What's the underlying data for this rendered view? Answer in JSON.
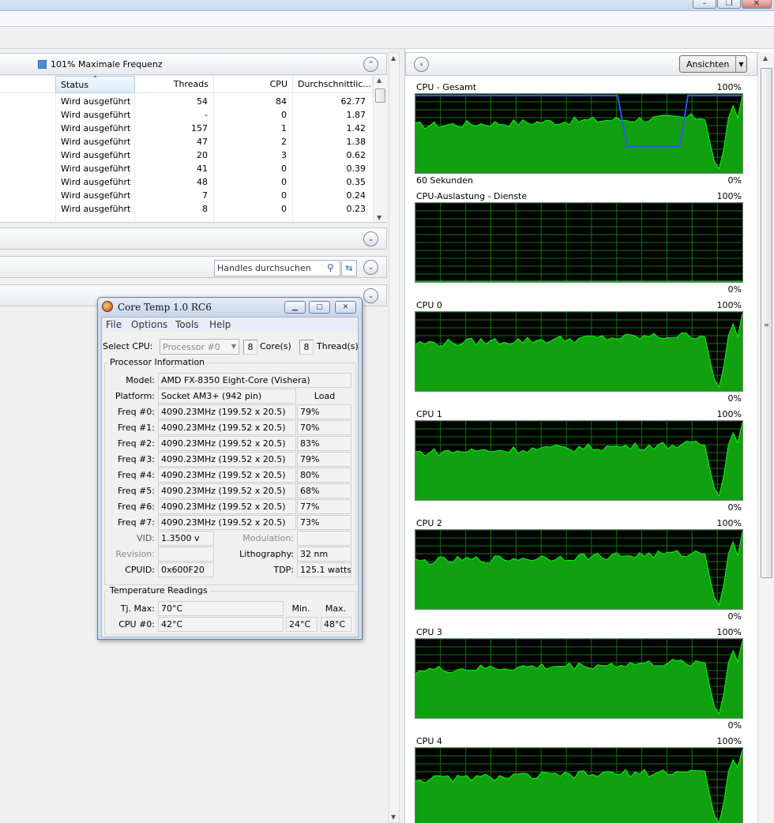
{
  "window": {
    "minimize_glyph": "–",
    "maximize_glyph": "❐",
    "close_glyph": "✕"
  },
  "left_pane": {
    "cpu_section": {
      "legend_label": "101% Maximale Frequenz",
      "legend_color": "#4a90d9"
    },
    "table": {
      "columns": [
        "Status",
        "Threads",
        "CPU",
        "Durchschnittlic..."
      ],
      "rows": [
        {
          "status": "Wird ausgeführt",
          "threads": "54",
          "cpu": "84",
          "avg": "62.77"
        },
        {
          "status": "Wird ausgeführt",
          "threads": "-",
          "cpu": "0",
          "avg": "1.87"
        },
        {
          "status": "Wird ausgeführt",
          "threads": "157",
          "cpu": "1",
          "avg": "1.42"
        },
        {
          "status": "Wird ausgeführt",
          "threads": "47",
          "cpu": "2",
          "avg": "1.38"
        },
        {
          "status": "Wird ausgeführt",
          "threads": "20",
          "cpu": "3",
          "avg": "0.62"
        },
        {
          "status": "Wird ausgeführt",
          "threads": "41",
          "cpu": "0",
          "avg": "0.39"
        },
        {
          "status": "Wird ausgeführt",
          "threads": "48",
          "cpu": "0",
          "avg": "0.35"
        },
        {
          "status": "Wird ausgeführt",
          "threads": "7",
          "cpu": "0",
          "avg": "0.24"
        },
        {
          "status": "Wird ausgeführt",
          "threads": "8",
          "cpu": "0",
          "avg": "0.23"
        }
      ]
    },
    "handles_search": {
      "placeholder": "Handles durchsuchen"
    }
  },
  "coretemp": {
    "title": "Core Temp 1.0 RC6",
    "menu": [
      "File",
      "Options",
      "Tools",
      "Help"
    ],
    "select_cpu_label": "Select CPU:",
    "select_cpu_value": "Processor #0",
    "cores_value": "8",
    "cores_label": "Core(s)",
    "threads_value": "8",
    "threads_label": "Thread(s)",
    "processor_info_title": "Processor Information",
    "model_label": "Model:",
    "model_value": "AMD FX-8350 Eight-Core (Vishera)",
    "platform_label": "Platform:",
    "platform_value": "Socket AM3+ (942 pin)",
    "load_header": "Load",
    "freqs": [
      {
        "label": "Freq #0:",
        "value": "4090.23MHz (199.52 x 20.5)",
        "load": "79%"
      },
      {
        "label": "Freq #1:",
        "value": "4090.23MHz (199.52 x 20.5)",
        "load": "70%"
      },
      {
        "label": "Freq #2:",
        "value": "4090.23MHz (199.52 x 20.5)",
        "load": "83%"
      },
      {
        "label": "Freq #3:",
        "value": "4090.23MHz (199.52 x 20.5)",
        "load": "79%"
      },
      {
        "label": "Freq #4:",
        "value": "4090.23MHz (199.52 x 20.5)",
        "load": "80%"
      },
      {
        "label": "Freq #5:",
        "value": "4090.23MHz (199.52 x 20.5)",
        "load": "68%"
      },
      {
        "label": "Freq #6:",
        "value": "4090.23MHz (199.52 x 20.5)",
        "load": "77%"
      },
      {
        "label": "Freq #7:",
        "value": "4090.23MHz (199.52 x 20.5)",
        "load": "73%"
      }
    ],
    "vid_label": "VID:",
    "vid_value": "1.3500 v",
    "modulation_label": "Modulation:",
    "modulation_value": "",
    "revision_label": "Revision:",
    "revision_value": "",
    "lithography_label": "Lithography:",
    "lithography_value": "32 nm",
    "cpuid_label": "CPUID:",
    "cpuid_value": "0x600F20",
    "tdp_label": "TDP:",
    "tdp_value": "125.1 watts",
    "temp_title": "Temperature Readings",
    "tjmax_label": "Tj. Max:",
    "tjmax_value": "70°C",
    "min_header": "Min.",
    "max_header": "Max.",
    "cpu0_label": "CPU #0:",
    "cpu0_value": "42°C",
    "cpu0_min": "24°C",
    "cpu0_max": "48°C"
  },
  "right_pane": {
    "views_button_label": "Ansichten",
    "time_label": "60 Sekunden",
    "graph_line_color": "#00ff00",
    "graph_fill_color": "#10a010",
    "freq_line_color": "#3355ee",
    "graphs": [
      {
        "title": "CPU - Gesamt",
        "max": "100%",
        "min": "0%"
      },
      {
        "title": "CPU-Auslastung - Dienste",
        "max": "100%",
        "min": "0%"
      },
      {
        "title": "CPU 0",
        "max": "100%",
        "min": "0%"
      },
      {
        "title": "CPU 1",
        "max": "100%",
        "min": "0%"
      },
      {
        "title": "CPU 2",
        "max": "100%",
        "min": "0%"
      },
      {
        "title": "CPU 3",
        "max": "100%",
        "min": "0%"
      },
      {
        "title": "CPU 4",
        "max": "100%",
        "min": ""
      }
    ]
  }
}
